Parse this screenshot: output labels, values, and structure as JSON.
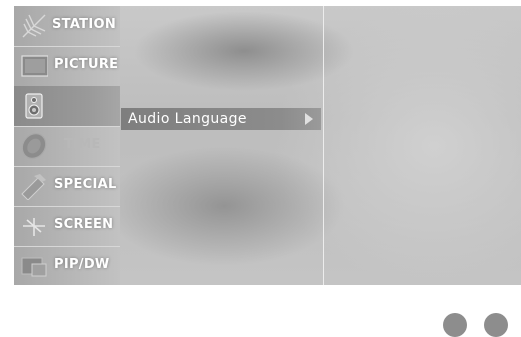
{
  "menu": {
    "items": [
      {
        "label": "STATION",
        "icon": "antenna-icon"
      },
      {
        "label": "PICTURE",
        "icon": "picture-icon"
      },
      {
        "label": "",
        "icon": "speaker-icon"
      },
      {
        "label": "TIME",
        "icon": "clock-icon"
      },
      {
        "label": "SPECIAL",
        "icon": "special-icon"
      },
      {
        "label": "SCREEN",
        "icon": "screen-icon"
      },
      {
        "label": "PIP/DW",
        "icon": "pip-icon"
      }
    ]
  },
  "submenu": {
    "label": "Audio Language",
    "arrow": "right-arrow-icon"
  },
  "colors": {
    "selected": "#8a8a8a",
    "indicator_dot": "#8d8d8d"
  }
}
